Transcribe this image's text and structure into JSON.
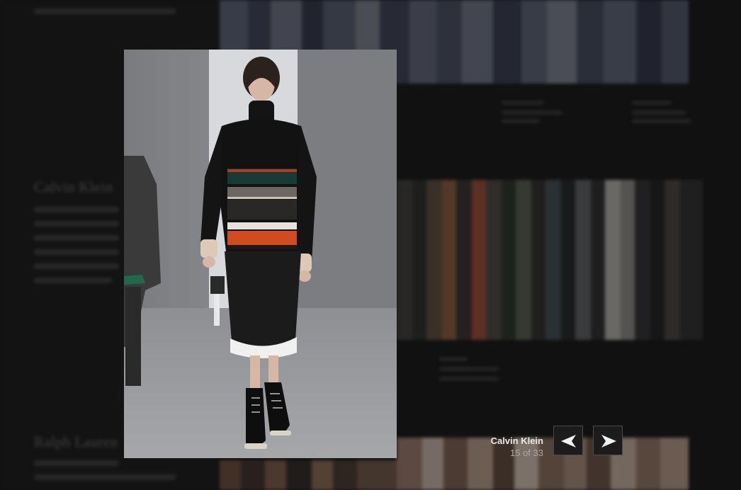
{
  "background": {
    "headings": [
      "Calvin Klein",
      "Ralph Lauren"
    ]
  },
  "modal": {
    "photo_alt": "Calvin Klein",
    "caption": {
      "designer": "Calvin Klein",
      "counter": "15 of 33"
    },
    "prev_icon": "left-arrow-icon",
    "next_icon": "right-arrow-icon"
  },
  "colors": {
    "overlay": "#111111",
    "button_bg": "#1c1c1c",
    "button_border": "#4a4a4a",
    "caption_title": "#e8e8e8",
    "caption_counter": "#a8a8a8"
  }
}
